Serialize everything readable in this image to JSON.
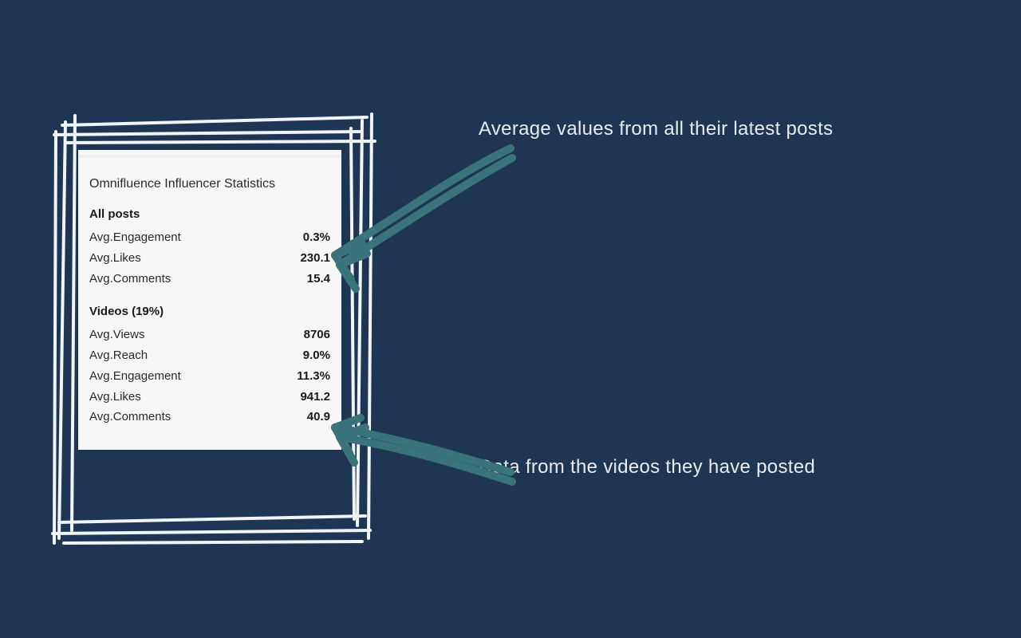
{
  "card": {
    "title": "Omnifluence Influencer Statistics",
    "all_posts": {
      "header": "All posts",
      "rows": {
        "engagement": {
          "label": "Avg.Engagement",
          "value": "0.3%"
        },
        "likes": {
          "label": "Avg.Likes",
          "value": "230.1"
        },
        "comments": {
          "label": "Avg.Comments",
          "value": "15.4"
        }
      }
    },
    "videos": {
      "header": "Videos (19%)",
      "rows": {
        "views": {
          "label": "Avg.Views",
          "value": "8706"
        },
        "reach": {
          "label": "Avg.Reach",
          "value": "9.0%"
        },
        "engagement": {
          "label": "Avg.Engagement",
          "value": "11.3%"
        },
        "likes": {
          "label": "Avg.Likes",
          "value": "941.2"
        },
        "comments": {
          "label": "Avg.Comments",
          "value": "40.9"
        }
      }
    }
  },
  "annotations": {
    "top": "Average values from all their latest posts",
    "bottom": "Data from the videos they have posted"
  }
}
